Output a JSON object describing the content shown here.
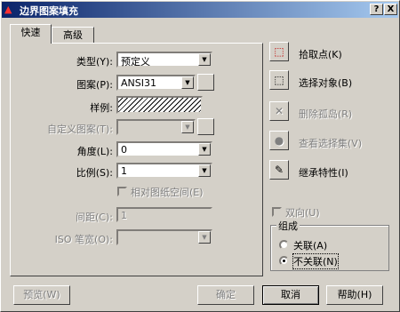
{
  "window": {
    "title": "边界图案填充",
    "help_btn": "?",
    "close_btn": "X"
  },
  "tabs": [
    {
      "label": "快速",
      "active": true
    },
    {
      "label": "高级",
      "active": false
    }
  ],
  "form": {
    "type_label": "类型(Y):",
    "type_value": "预定义",
    "pattern_label": "图案(P):",
    "pattern_value": "ANSI31",
    "sample_label": "样例:",
    "custom_label": "自定义图案(T):",
    "custom_value": "",
    "angle_label": "角度(L):",
    "angle_value": "0",
    "scale_label": "比例(S):",
    "scale_value": "1",
    "relative_label": "相对图纸空间(E)",
    "spacing_label": "间距(C):",
    "spacing_value": "1",
    "iso_label": "ISO 笔宽(O):",
    "iso_value": ""
  },
  "actions": [
    {
      "label": "拾取点(K)",
      "icon": "pick-points-icon",
      "enabled": true
    },
    {
      "label": "选择对象(B)",
      "icon": "select-objects-icon",
      "enabled": true
    },
    {
      "label": "删除孤岛(R)",
      "icon": "remove-islands-icon",
      "enabled": false
    },
    {
      "label": "查看选择集(V)",
      "icon": "view-selection-icon",
      "enabled": false
    },
    {
      "label": "继承特性(I)",
      "icon": "inherit-properties-icon",
      "enabled": true
    }
  ],
  "double_label": "双向(U)",
  "composition": {
    "title": "组成",
    "associative": "关联(A)",
    "nonassociative": "不关联(N)",
    "selected": "nonassociative"
  },
  "buttons": {
    "preview": "预览(W)",
    "ok": "确定",
    "cancel": "取消",
    "help": "帮助(H)"
  }
}
